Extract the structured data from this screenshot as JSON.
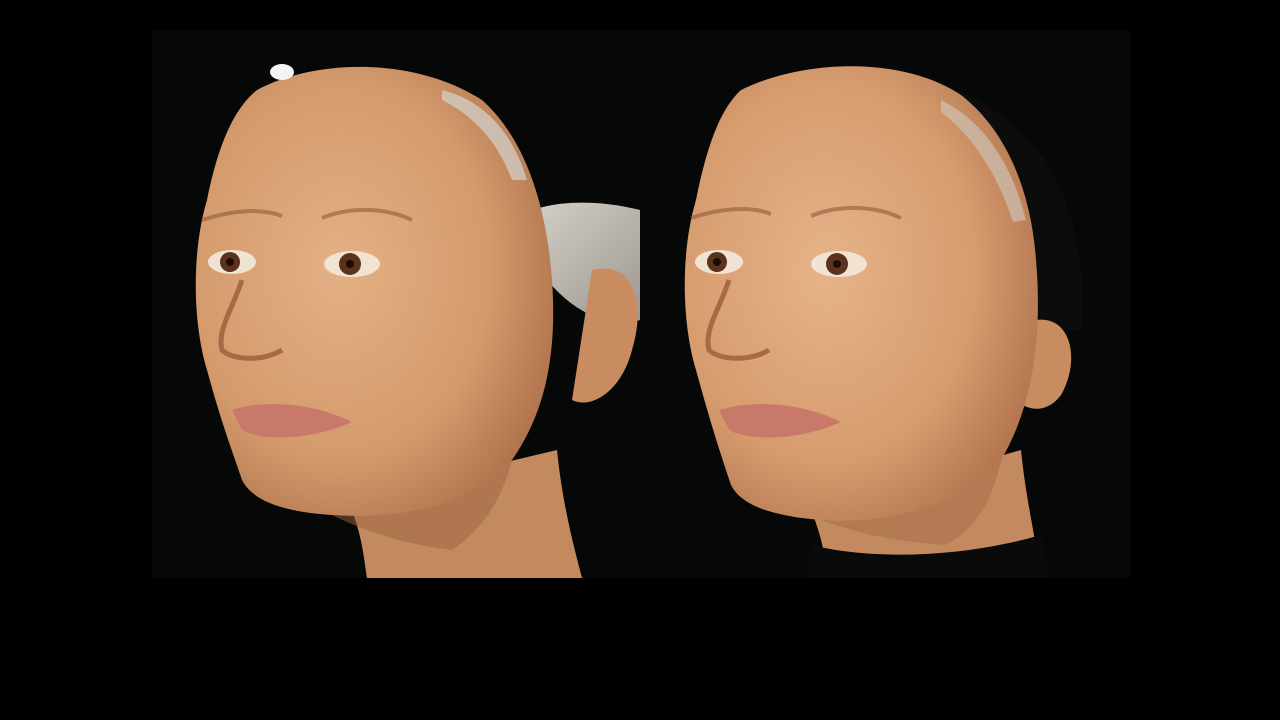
{
  "scene": {
    "background_color": "#000000",
    "panel_color": "#050807",
    "skin_color": "#d59a6d",
    "lip_color": "#c9796a"
  },
  "photos": [
    {
      "name": "before-photo"
    },
    {
      "name": "after-photo"
    }
  ]
}
